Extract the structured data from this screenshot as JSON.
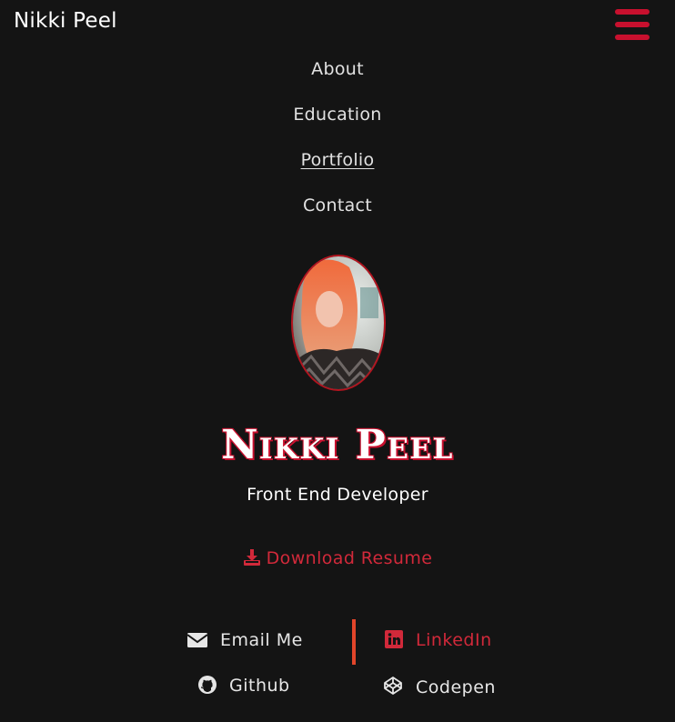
{
  "header": {
    "brand": "Nikki Peel",
    "menu_icon": "hamburger-menu-icon",
    "accent_color": "#c8102e"
  },
  "nav": {
    "items": [
      {
        "label": "About",
        "active": false
      },
      {
        "label": "Education",
        "active": false
      },
      {
        "label": "Portfolio",
        "active": true
      },
      {
        "label": "Contact",
        "active": false
      }
    ]
  },
  "hero": {
    "avatar_icon": "profile-photo",
    "name": "Nikki Peel",
    "title": "Front End Developer",
    "resume_label": "Download Resume",
    "resume_icon": "download-icon"
  },
  "links": {
    "email": {
      "label": "Email Me",
      "icon": "envelope-icon"
    },
    "linkedin": {
      "label": "LinkedIn",
      "icon": "linkedin-icon"
    },
    "github": {
      "label": "Github",
      "icon": "github-icon"
    },
    "codepen": {
      "label": "Codepen",
      "icon": "codepen-icon"
    }
  }
}
